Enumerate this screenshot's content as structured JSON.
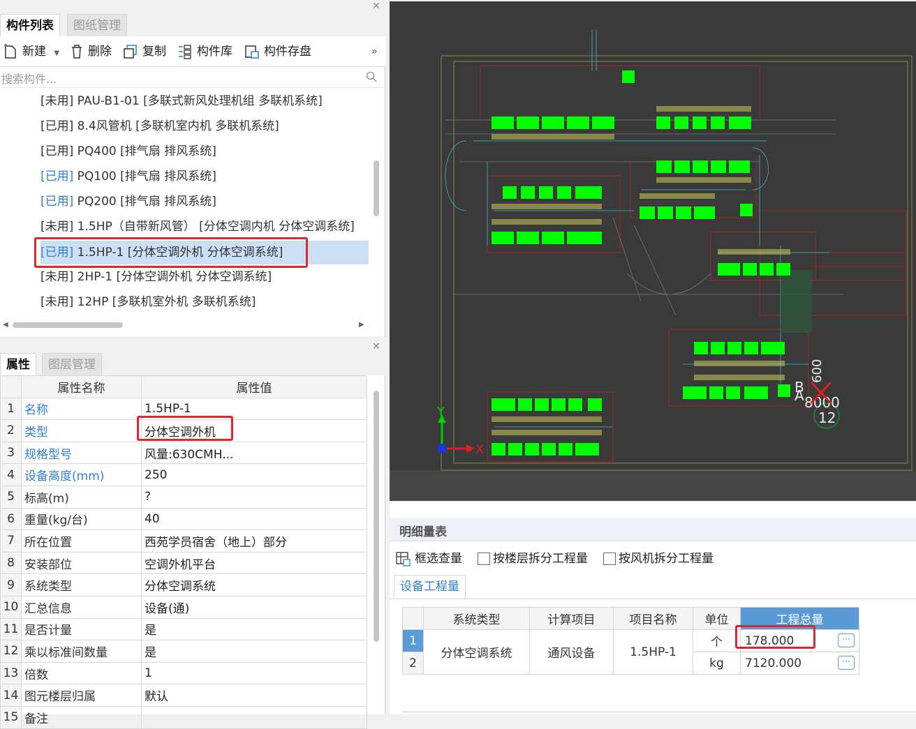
{
  "component_panel": {
    "tabs": [
      {
        "label": "构件列表"
      },
      {
        "label": "图纸管理"
      }
    ],
    "toolbar": {
      "new": "新建",
      "delete": "删除",
      "copy": "复制",
      "library": "构件库",
      "save": "构件存盘",
      "more": "»"
    },
    "search_placeholder": "搜索构件...",
    "items": [
      {
        "status": "[未用]",
        "text": " PAU-B1-01 [多联式新风处理机组 多联机系统]"
      },
      {
        "status": "[已用]",
        "text": " 8.4风管机 [多联机室内机 多联机系统]"
      },
      {
        "status": "[已用]",
        "text": " PQ400 [排气扇 排风系统]"
      },
      {
        "status": "[已用]",
        "text": " PQ100 [排气扇 排风系统]"
      },
      {
        "status": "[已用]",
        "text": " PQ200 [排气扇 排风系统]"
      },
      {
        "status": "[未用]",
        "text": " 1.5HP（自带新风管） [分体空调内机 分体空调系统]"
      },
      {
        "status": "[已用]",
        "text": " 1.5HP-1 [分体空调外机 分体空调系统]"
      },
      {
        "status": "[未用]",
        "text": " 2HP-1 [分体空调外机 分体空调系统]"
      },
      {
        "status": "[未用]",
        "text": " 12HP [多联机室外机 多联机系统]"
      }
    ]
  },
  "property_panel": {
    "tabs": [
      {
        "label": "属性"
      },
      {
        "label": "图层管理"
      }
    ],
    "headers": {
      "name": "属性名称",
      "value": "属性值"
    },
    "rows": [
      {
        "n": "1",
        "key": "名称",
        "value": "1.5HP-1"
      },
      {
        "n": "2",
        "key": "类型",
        "value": "分体空调外机"
      },
      {
        "n": "3",
        "key": "规格型号",
        "value": "风量:630CMH..."
      },
      {
        "n": "4",
        "key": "设备高度(mm)",
        "value": "250"
      },
      {
        "n": "5",
        "key": "标高(m)",
        "value": "?"
      },
      {
        "n": "6",
        "key": "重量(kg/台)",
        "value": "40"
      },
      {
        "n": "7",
        "key": "所在位置",
        "value": "西苑学员宿舍（地上）部分"
      },
      {
        "n": "8",
        "key": "安装部位",
        "value": "空调外机平台"
      },
      {
        "n": "9",
        "key": "系统类型",
        "value": "分体空调系统"
      },
      {
        "n": "10",
        "key": "汇总信息",
        "value": "设备(通)"
      },
      {
        "n": "11",
        "key": "是否计量",
        "value": "是"
      },
      {
        "n": "12",
        "key": "乘以标准间数量",
        "value": "是"
      },
      {
        "n": "13",
        "key": "倍数",
        "value": "1"
      },
      {
        "n": "14",
        "key": "图元楼层归属",
        "value": "默认"
      },
      {
        "n": "15",
        "key": "备注",
        "value": ""
      }
    ]
  },
  "cad": {
    "axis_y": "Y",
    "axis_x": "X",
    "label_a": "B",
    "label_b": "A",
    "label_dim": "8000",
    "label_dim2": "600",
    "label_num": "12"
  },
  "quantity_panel": {
    "title": "明细量表",
    "frame_select": "框选查量",
    "opt_floor": "按楼层拆分工程量",
    "opt_fan": "按风机拆分工程量",
    "tab": "设备工程量",
    "headers": {
      "sys": "系统类型",
      "calc": "计算项目",
      "item": "项目名称",
      "unit": "单位",
      "total": "工程总量"
    },
    "system": "分体空调系统",
    "calc_item": "通风设备",
    "item_name": "1.5HP-1",
    "rows": [
      {
        "n": "1",
        "unit": "个",
        "total": "178.000"
      },
      {
        "n": "2",
        "unit": "kg",
        "total": "7120.000"
      }
    ],
    "ellipsis": "···"
  },
  "colors": {
    "accent": "#2f7fd6",
    "highlight_red": "#e0262a",
    "selection": "#cce0f5",
    "cad_bg": "#3a3a3a",
    "cad_green": "#00ff00"
  }
}
